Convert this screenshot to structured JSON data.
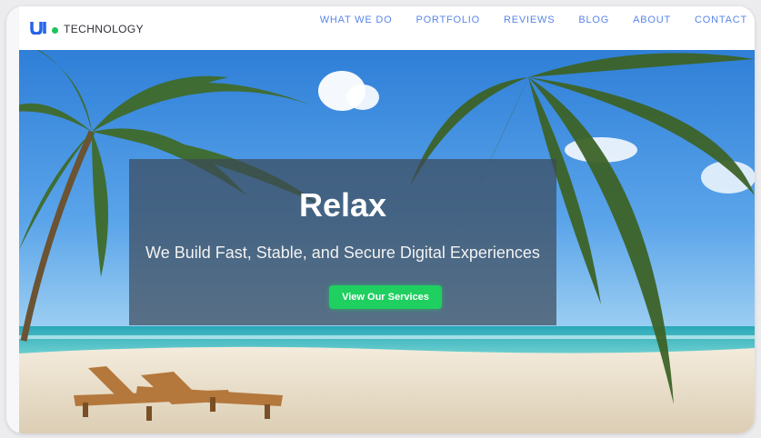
{
  "header": {
    "logo_text": "TECHNOLOGY",
    "nav": [
      "WHAT WE DO",
      "PORTFOLIO",
      "REVIEWS",
      "BLOG",
      "ABOUT",
      "CONTACT"
    ]
  },
  "hero": {
    "title": "Relax",
    "subtitle": "We Build Fast, Stable, and Secure Digital Experiences",
    "cta_label": "View Our Services"
  },
  "colors": {
    "nav_link": "#5a86e8",
    "cta": "#1fcf60",
    "logo_dot": "#1dc25a",
    "logo_mark": "#2563eb"
  }
}
